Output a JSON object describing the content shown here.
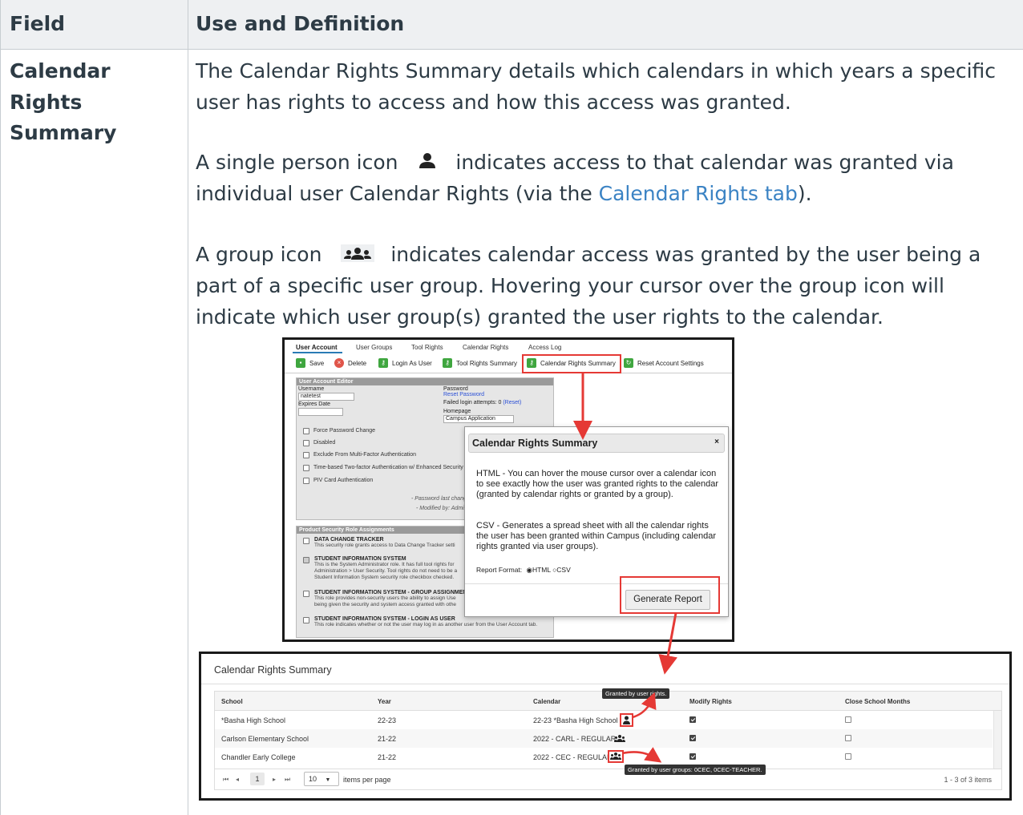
{
  "header": {
    "field": "Field",
    "use_definition": "Use and Definition"
  },
  "row": {
    "field_name": "Calendar Rights Summary",
    "p1": "The Calendar Rights Summary details which calendars in which years a specific user has rights to access and how this access was granted.",
    "p2_a": "A single person icon",
    "p2_b": "indicates access to that calendar was granted via individual user Calendar Rights (via the",
    "p2_link": "Calendar Rights tab",
    "p2_c": ").",
    "p3_a": "A group icon",
    "p3_b": "indicates calendar access was granted by the user being a part of a specific user group. Hovering your cursor over the group icon will indicate which user group(s) granted the user rights to the calendar."
  },
  "screenshot1": {
    "tabs": [
      "User Account",
      "User Groups",
      "Tool Rights",
      "Calendar Rights",
      "Access Log"
    ],
    "toolbar": {
      "save": "Save",
      "delete": "Delete",
      "login_as_user": "Login As User",
      "tool_rights_summary": "Tool Rights Summary",
      "calendar_rights_summary": "Calendar Rights Summary",
      "reset_account_settings": "Reset Account Settings"
    },
    "editor": {
      "title": "User Account Editor",
      "username_label": "Username",
      "username_value": "natetest",
      "expires_label": "Expires Date",
      "password_label": "Password",
      "reset_password": "Reset Password",
      "failed_login": "Failed login attempts: 0",
      "reset": "(Reset)",
      "homepage_label": "Homepage",
      "homepage_value": "Campus Application",
      "checkboxes": [
        "Force Password Change",
        "Disabled",
        "Exclude From Multi-Factor Authentication",
        "Time-based Two-factor Authentication w/ Enhanced Security",
        "PIV Card Authentication"
      ],
      "pw_changed": "- Password last chang",
      "modified_by": "- Modified by: Admin"
    },
    "roles": {
      "title": "Product Security Role Assignments",
      "items": [
        {
          "name": "DATA CHANGE TRACKER",
          "desc": "This security role grants access to Data Change Tracker setti"
        },
        {
          "name": "STUDENT INFORMATION SYSTEM",
          "desc": "This is the System Administrator role. It has full tool rights for Administration > User Security. Tool rights do not need to be a Student Information System security role checkbox checked."
        },
        {
          "name": "STUDENT INFORMATION SYSTEM - GROUP ASSIGNMENT",
          "desc": "This role provides non-security users the ability to assign Use being given the security and system access granted with othe"
        },
        {
          "name": "STUDENT INFORMATION SYSTEM - LOGIN AS USER",
          "desc": "This role indicates whether or not the user may log in as another user from the User Account tab."
        }
      ]
    },
    "modal": {
      "title": "Calendar Rights Summary",
      "close": "×",
      "html_label": "HTML",
      "html_text": " - You can hover the mouse cursor over a calendar icon to see exactly how the user was granted rights to the calendar (granted by calendar rights or granted by a group).",
      "csv_label": "CSV",
      "csv_text": " - Generates a spread sheet with all the calendar rights the user has been granted within Campus (including calendar rights granted via user groups).",
      "report_format": "Report Format:",
      "opt_html": "HTML",
      "opt_csv": "CSV",
      "generate": "Generate Report"
    }
  },
  "screenshot2": {
    "title": "Calendar Rights Summary",
    "columns": [
      "School",
      "Year",
      "Calendar",
      "Modify Rights",
      "Close School Months"
    ],
    "rows": [
      {
        "school": "*Basha High School",
        "year": "22-23",
        "calendar": "22-23 *Basha High School",
        "icon": "user-icon",
        "modify": true,
        "close": false
      },
      {
        "school": "Carlson Elementary School",
        "year": "21-22",
        "calendar": "2022 - CARL - REGULAR",
        "icon": "group-icon",
        "modify": true,
        "close": false
      },
      {
        "school": "Chandler Early College",
        "year": "21-22",
        "calendar": "2022 - CEC - REGULAR",
        "icon": "group-icon",
        "modify": true,
        "close": false
      }
    ],
    "tooltip_user": "Granted by user rights.",
    "tooltip_group": "Granted by user groups: 0CEC, 0CEC-TEACHER.",
    "pager": {
      "page": "1",
      "items_per_page": "10",
      "items_per_page_label": "items per page",
      "range": "1 - 3 of 3 items"
    }
  },
  "colors": {
    "accent_red": "#e53935",
    "link_blue": "#3b83c4",
    "green_icon": "#3fa63f"
  }
}
